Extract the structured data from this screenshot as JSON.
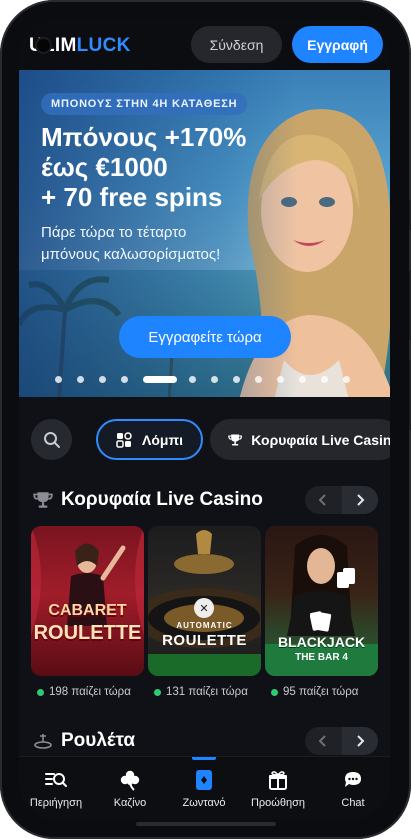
{
  "brand": {
    "logo_part1": "U",
    "logo_part2": "LIM",
    "logo_part3": "LUCK"
  },
  "header": {
    "login_label": "Σύνδεση",
    "register_label": "Εγγραφή"
  },
  "banner": {
    "badge": "ΜΠΟΝΟΥΣ ΣΤΗΝ 4Η ΚΑΤΑΘΕΣΗ",
    "headline_line1": "Μπόνους +170%",
    "headline_line2": "έως €1000",
    "headline_line3": "+ 70 free spins",
    "subline": "Πάρε τώρα το τέταρτο μπόνους καλωσορίσματος!",
    "cta_label": "Εγγραφείτε τώρα",
    "slide_count": 13,
    "active_slide": 5
  },
  "chips": [
    {
      "label": "Λόμπι",
      "icon": "lobby-icon",
      "active": true
    },
    {
      "label": "Κορυφαία Live Casino",
      "icon": "trophy-icon",
      "active": false
    }
  ],
  "sections": {
    "live": {
      "title": "Κορυφαία Live Casino",
      "icon": "trophy-icon",
      "cards": [
        {
          "name_line1": "CABARET",
          "name_line2": "ROULETTE",
          "players": "198 παίζει τώρα"
        },
        {
          "name_line1": "AUTOMATIC",
          "name_line2": "ROULETTE",
          "players": "131 παίζει τώρα"
        },
        {
          "name_line1": "BLACKJACK",
          "name_line2": "THE BAR 4",
          "players": "95 παίζει τώρα"
        }
      ]
    },
    "roulette": {
      "title": "Ρουλέτα",
      "icon": "roulette-icon"
    }
  },
  "bottom_nav": [
    {
      "label": "Περιήγηση",
      "icon": "browse-icon",
      "active": false
    },
    {
      "label": "Καζίνο",
      "icon": "clover-icon",
      "active": false
    },
    {
      "label": "Ζωντανό",
      "icon": "live-cards-icon",
      "active": true
    },
    {
      "label": "Προώθηση",
      "icon": "gift-icon",
      "active": false
    },
    {
      "label": "Chat",
      "icon": "chat-icon",
      "active": false
    }
  ],
  "colors": {
    "accent": "#1f84ff",
    "background": "#101116",
    "online": "#2ecc71"
  }
}
